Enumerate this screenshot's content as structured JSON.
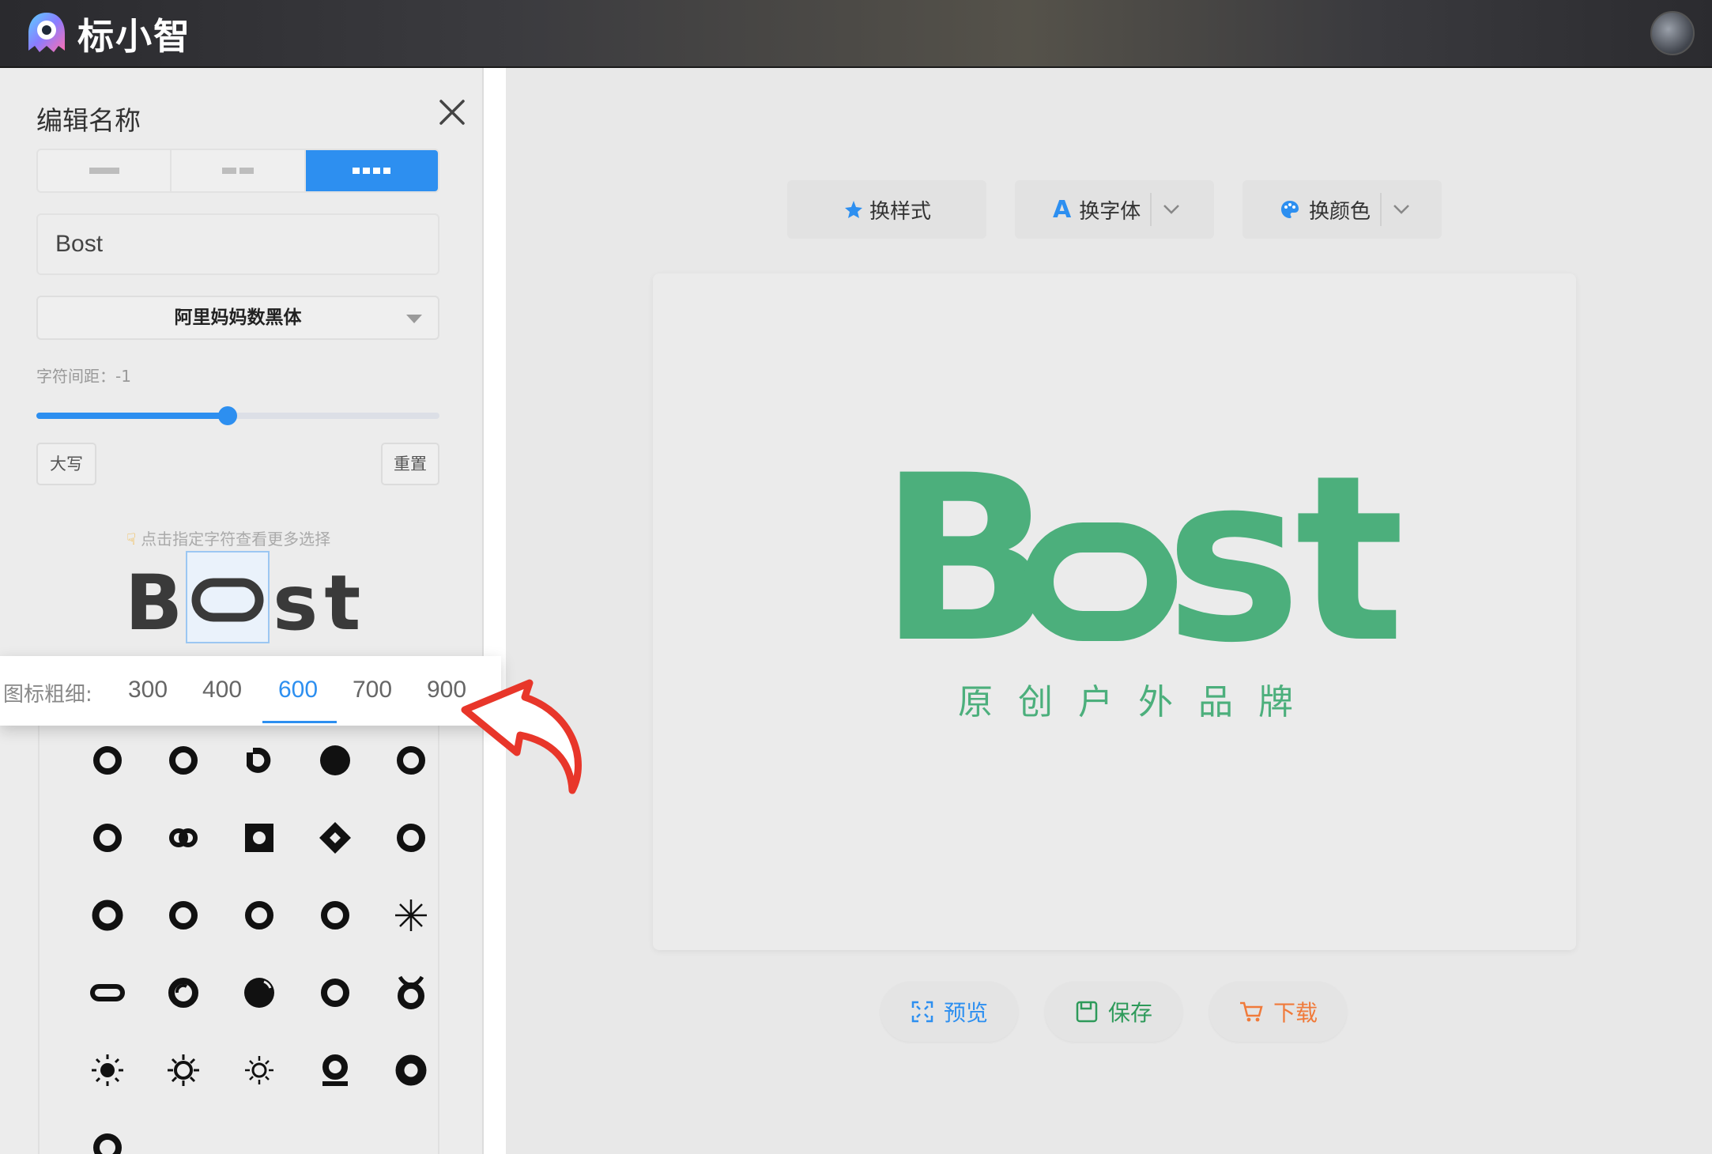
{
  "app": {
    "name": "标小智"
  },
  "panel": {
    "title": "编辑名称",
    "name_value": "Bost",
    "font_name": "阿里妈妈数黑体",
    "spacing_label": "字符间距：-1",
    "spacing_value": -1,
    "spacing_fraction": 0.475,
    "uppercase_label": "大写",
    "reset_label": "重置",
    "hint": "点击指定字符查看更多选择",
    "chars": [
      "B",
      "o",
      "s",
      "t"
    ],
    "selected_char_index": 1
  },
  "weight_popover": {
    "label": "图标粗细:",
    "options": [
      "300",
      "400",
      "600",
      "700",
      "900"
    ],
    "active": "600"
  },
  "toolbar": {
    "style_label": "换样式",
    "font_label": "换字体",
    "color_label": "换颜色"
  },
  "preview": {
    "logo_text": "Bost",
    "slogan": "原创户外品牌",
    "brand_color": "#4caf7c"
  },
  "actions": {
    "preview_label": "预览",
    "save_label": "保存",
    "download_label": "下载"
  },
  "colors": {
    "accent": "#2d8ff0",
    "brand": "#4caf7c",
    "save": "#2e9a5a",
    "download": "#f07a3a",
    "annotation": "#e8362a"
  }
}
